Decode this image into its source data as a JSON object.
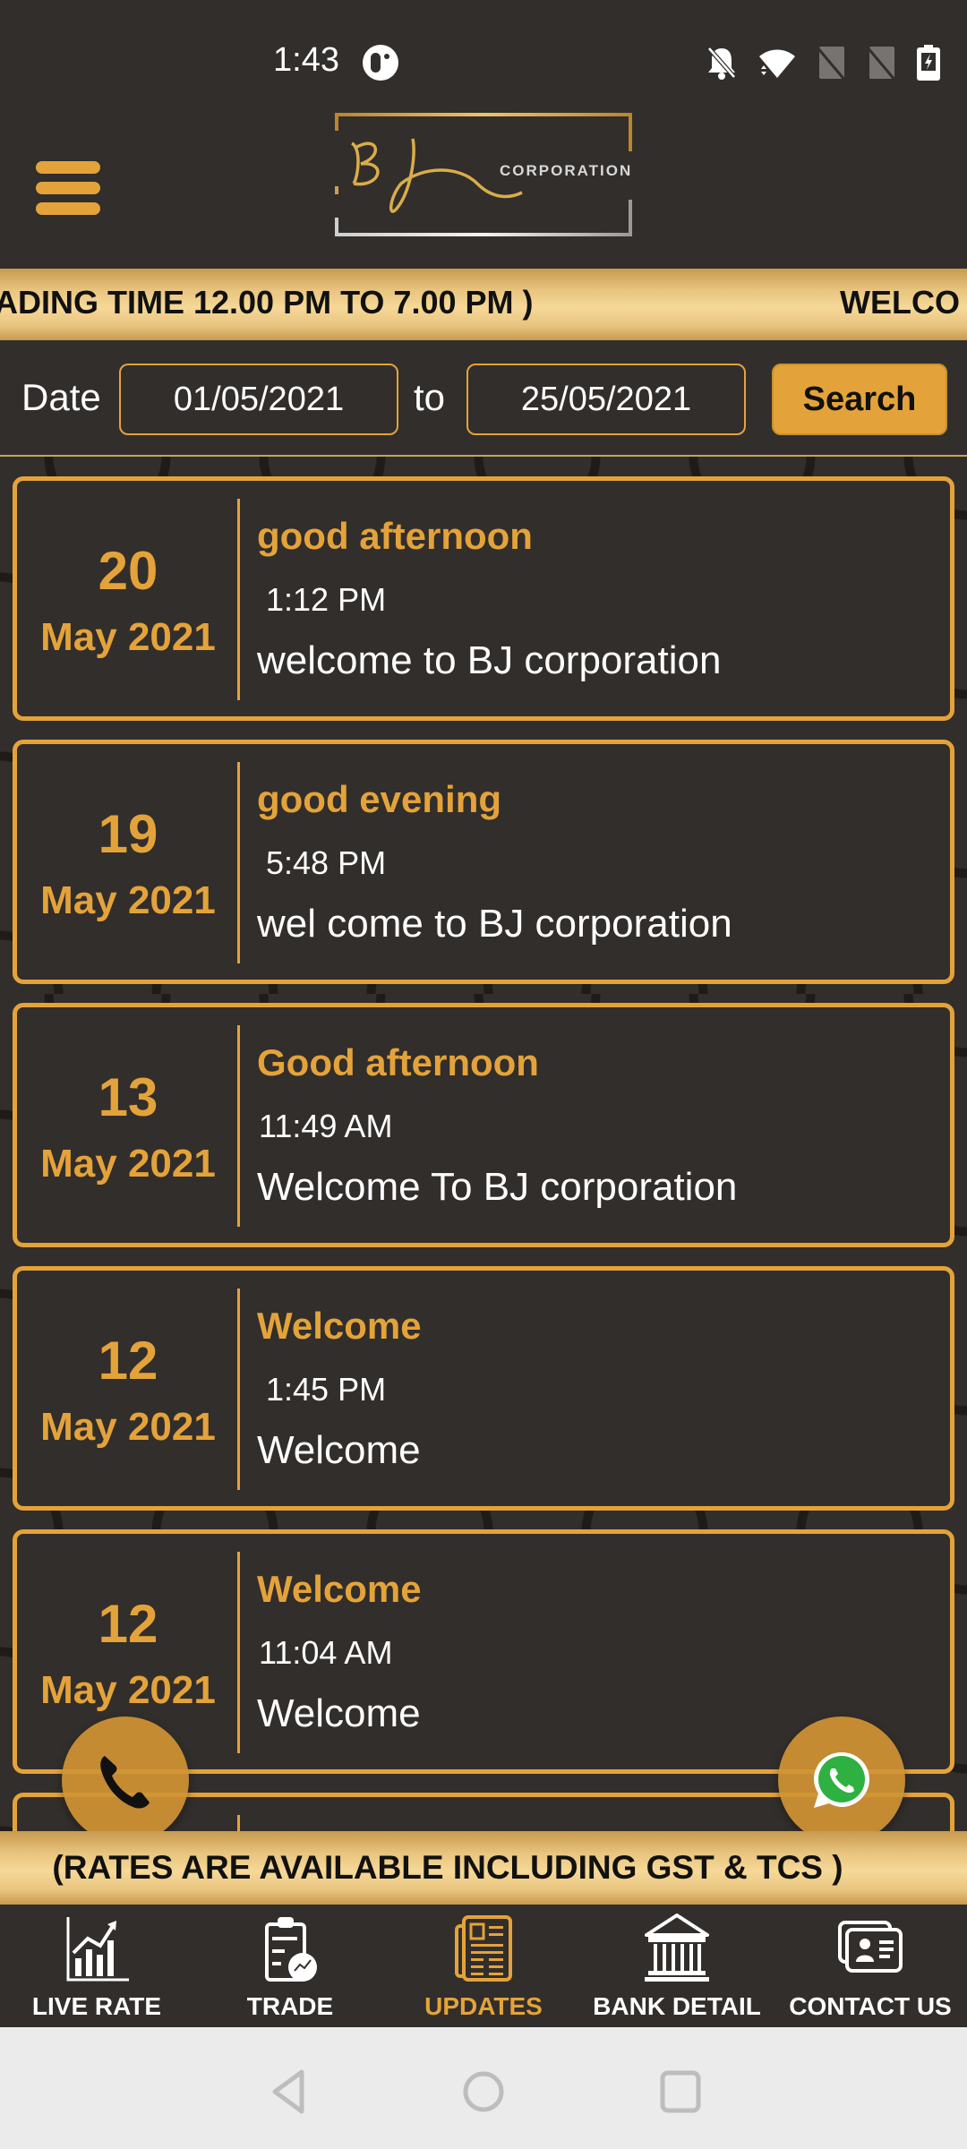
{
  "status_bar": {
    "time": "1:43",
    "icons": [
      "app-notification-icon",
      "bell-off-icon",
      "wifi-icon",
      "no-sim-icon",
      "no-sim-icon",
      "battery-charging-icon"
    ]
  },
  "header": {
    "menu_icon": "hamburger-menu-icon",
    "logo": {
      "monogram": "B J",
      "wordmark": "CORPORATION"
    }
  },
  "marquee": {
    "text": "ADING TIME 12.00 PM TO 7.00 PM )",
    "next_text": "WELCO"
  },
  "date_filter": {
    "label": "Date",
    "from_value": "01/05/2021",
    "separator": "to",
    "to_value": "25/05/2021",
    "search_label": "Search"
  },
  "updates": [
    {
      "day": "20",
      "month_year": "May 2021",
      "title": "good afternoon",
      "time": "1:12 PM",
      "message": "welcome to BJ corporation"
    },
    {
      "day": "19",
      "month_year": "May 2021",
      "title": "good evening",
      "time": "5:48 PM",
      "message": "wel come to BJ corporation"
    },
    {
      "day": "13",
      "month_year": "May 2021",
      "title": "Good afternoon",
      "time": "11:49 AM",
      "message": "Welcome To BJ corporation"
    },
    {
      "day": "12",
      "month_year": "May 2021",
      "title": "Welcome",
      "time": "1:45 PM",
      "message": "Welcome"
    },
    {
      "day": "12",
      "month_year": "May 2021",
      "title": "Welcome",
      "time": "11:04 AM",
      "message": "Welcome"
    }
  ],
  "fabs": {
    "call_icon": "phone-icon",
    "whatsapp_icon": "whatsapp-icon"
  },
  "rates_band": {
    "text": "(RATES ARE AVAILABLE INCLUDING GST & TCS )"
  },
  "bottom_nav": {
    "items": [
      {
        "label": "LIVE RATE",
        "icon": "chart-icon",
        "active": false
      },
      {
        "label": "TRADE",
        "icon": "clipboard-chart-icon",
        "active": false
      },
      {
        "label": "UPDATES",
        "icon": "newspaper-icon",
        "active": true
      },
      {
        "label": "BANK DETAIL",
        "icon": "bank-icon",
        "active": false
      },
      {
        "label": "CONTACT US",
        "icon": "contact-card-icon",
        "active": false
      }
    ]
  },
  "colors": {
    "background": "#322e2b",
    "accent_gold": "#e4a33a",
    "band_gold": "#f6d898",
    "system_nav": "#ebebeb"
  }
}
